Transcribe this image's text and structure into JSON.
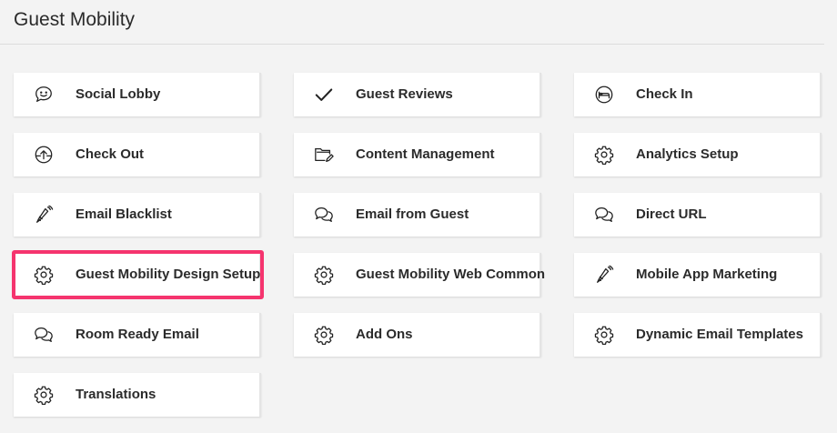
{
  "page": {
    "title": "Guest Mobility"
  },
  "tiles": [
    {
      "label": "Social Lobby",
      "icon": "smiley-chat-icon"
    },
    {
      "label": "Guest Reviews",
      "icon": "checkmark-icon"
    },
    {
      "label": "Check In",
      "icon": "bed-icon"
    },
    {
      "label": "Check Out",
      "icon": "upload-circle-icon"
    },
    {
      "label": "Content Management",
      "icon": "folder-edit-icon"
    },
    {
      "label": "Analytics Setup",
      "icon": "gear-icon"
    },
    {
      "label": "Email Blacklist",
      "icon": "megaphone-icon"
    },
    {
      "label": "Email from Guest",
      "icon": "chat-bubbles-icon"
    },
    {
      "label": "Direct URL",
      "icon": "chat-bubbles-icon"
    },
    {
      "label": "Guest Mobility Design Setup",
      "icon": "gear-icon"
    },
    {
      "label": "Guest Mobility Web Common",
      "icon": "gear-icon"
    },
    {
      "label": "Mobile App Marketing",
      "icon": "megaphone-icon"
    },
    {
      "label": "Room Ready Email",
      "icon": "chat-bubbles-icon"
    },
    {
      "label": "Add Ons",
      "icon": "gear-icon"
    },
    {
      "label": "Dynamic Email Templates",
      "icon": "gear-icon"
    },
    {
      "label": "Translations",
      "icon": "gear-icon"
    }
  ],
  "highlighted_tile": "Guest Mobility Design Setup",
  "colors": {
    "highlight": "#f5346e",
    "background": "#f3f3f3",
    "tile": "#ffffff"
  }
}
